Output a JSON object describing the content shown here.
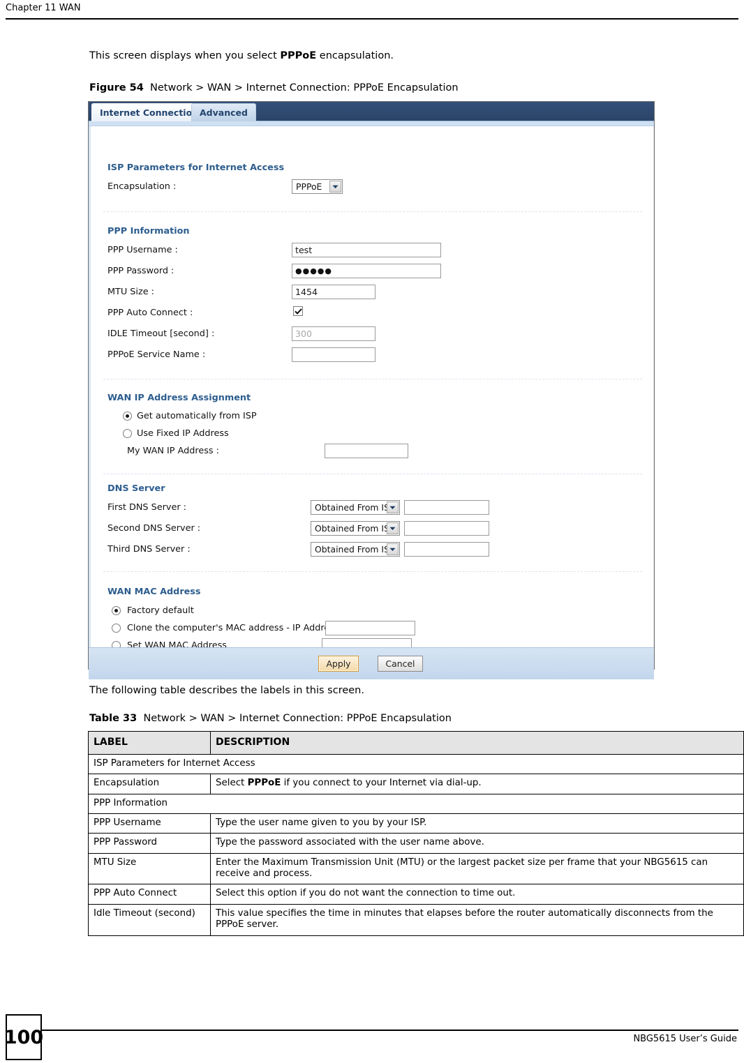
{
  "page": {
    "chapter_header": "Chapter 11 WAN",
    "intro_text_before": "This screen displays when you select ",
    "intro_text_bold": "PPPoE",
    "intro_text_after": " encapsulation.",
    "figure_label": "Figure 54",
    "figure_caption": "Network > WAN > Internet Connection: PPPoE Encapsulation",
    "after_figure_text": "The following table describes the labels in this screen.",
    "table_label": "Table 33",
    "table_caption": "Network > WAN > Internet Connection: PPPoE Encapsulation",
    "page_number": "100",
    "footer_text": "NBG5615 User’s Guide"
  },
  "screenshot": {
    "tabs": [
      {
        "label": "Internet Connection",
        "active": true
      },
      {
        "label": "Advanced",
        "active": false
      }
    ],
    "sections": {
      "isp": {
        "title": "ISP Parameters for Internet Access",
        "encapsulation_label": "Encapsulation :",
        "encapsulation_value": "PPPoE"
      },
      "ppp": {
        "title": "PPP Information",
        "username_label": "PPP Username :",
        "username_value": "test",
        "password_label": "PPP Password :",
        "password_value": "●●●●●",
        "mtu_label": "MTU Size :",
        "mtu_value": "1454",
        "auto_connect_label": "PPP Auto Connect :",
        "auto_connect_checked": true,
        "idle_timeout_label": "IDLE Timeout [second] :",
        "idle_timeout_value": "300",
        "service_name_label": "PPPoE Service Name :",
        "service_name_value": ""
      },
      "wan_ip": {
        "title": "WAN IP Address Assignment",
        "option_auto": "Get automatically from ISP",
        "option_fixed": "Use Fixed IP Address",
        "my_wan_ip_label": "My WAN IP Address :",
        "my_wan_ip_value": "",
        "selected": "auto"
      },
      "dns": {
        "title": "DNS Server",
        "rows": [
          {
            "label": "First DNS Server :",
            "select_value": "Obtained From ISP",
            "text_value": ""
          },
          {
            "label": "Second DNS Server :",
            "select_value": "Obtained From ISP",
            "text_value": ""
          },
          {
            "label": "Third DNS Server :",
            "select_value": "Obtained From ISP",
            "text_value": ""
          }
        ]
      },
      "wan_mac": {
        "title": "WAN MAC Address",
        "option_factory": "Factory default",
        "option_clone": "Clone the computer's MAC address - IP Address",
        "option_clone_value": "",
        "option_set": "Set WAN MAC Address",
        "option_set_value": "",
        "selected": "factory"
      }
    },
    "buttons": {
      "apply": "Apply",
      "cancel": "Cancel"
    }
  },
  "table": {
    "headers": [
      "LABEL",
      "DESCRIPTION"
    ],
    "rows": [
      {
        "type": "section",
        "label": "ISP Parameters for Internet Access"
      },
      {
        "type": "row",
        "label": "Encapsulation",
        "desc_before": "Select ",
        "desc_bold": "PPPoE",
        "desc_after": " if you connect to your Internet via dial-up."
      },
      {
        "type": "section",
        "label": "PPP Information"
      },
      {
        "type": "row",
        "label": "PPP Username",
        "desc": "Type the user name given to you by your ISP."
      },
      {
        "type": "row",
        "label": "PPP Password",
        "desc": "Type the password associated with the user name above."
      },
      {
        "type": "row",
        "label": "MTU Size",
        "desc": "Enter the Maximum Transmission Unit (MTU) or the largest packet size per frame that your NBG5615 can receive and process."
      },
      {
        "type": "row",
        "label": "PPP Auto Connect",
        "desc": "Select this option if you do not want the connection to time out."
      },
      {
        "type": "row",
        "label": "Idle Timeout (second)",
        "desc": "This value specifies the time in minutes that elapses before the router automatically disconnects from the PPPoE server."
      }
    ]
  }
}
